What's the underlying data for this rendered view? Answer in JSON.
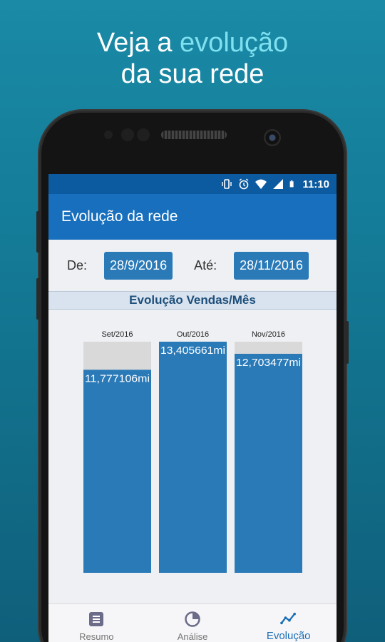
{
  "headline": {
    "line1_pre": "Veja a ",
    "line1_accent": "evolução",
    "line2": "da sua rede"
  },
  "status_bar": {
    "time": "11:10",
    "icons": [
      "vibrate-icon",
      "alarm-icon",
      "wifi-icon",
      "signal-icon",
      "battery-icon"
    ]
  },
  "app_bar": {
    "title": "Evolução da rede"
  },
  "filters": {
    "from_label": "De:",
    "from_value": "28/9/2016",
    "to_label": "Até:",
    "to_value": "28/11/2016"
  },
  "section": {
    "title": "Evolução Vendas/Mês"
  },
  "chart_data": {
    "type": "bar",
    "categories": [
      "Set/2016",
      "Out/2016",
      "Nov/2016"
    ],
    "values": [
      11.777106,
      13.405661,
      12.703477
    ],
    "data_labels": [
      "11,777106mi",
      "13,405661mi",
      "12,703477mi"
    ],
    "ylim": [
      0,
      13.405661
    ],
    "colors": {
      "bar": "#2a7ab8",
      "track": "#d9d9d9"
    }
  },
  "bottom_nav": [
    {
      "label": "Resumo",
      "icon": "list-icon",
      "active": false
    },
    {
      "label": "Análise",
      "icon": "pie-chart-icon",
      "active": false
    },
    {
      "label": "Evolução",
      "icon": "trend-icon",
      "active": true
    }
  ],
  "colors": {
    "status_bar": "#0c5aa0",
    "app_bar": "#176fbd",
    "accent": "#2a7ab8",
    "active_nav": "#1a6db5"
  }
}
